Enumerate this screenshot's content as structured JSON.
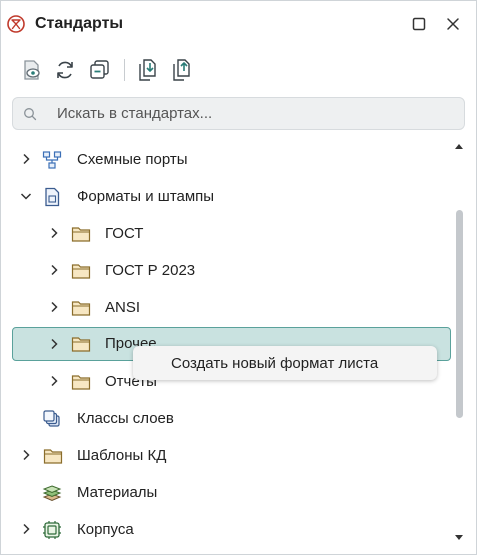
{
  "window": {
    "title": "Стандарты",
    "maximize_icon": "square-icon",
    "close_icon": "close-icon"
  },
  "toolbar": {
    "buttons": [
      {
        "name": "view-icon"
      },
      {
        "name": "refresh-icon"
      },
      {
        "name": "collapse-icon"
      },
      {
        "name": "import-icon"
      },
      {
        "name": "export-icon"
      }
    ]
  },
  "search": {
    "placeholder": "Искать в стандартах...",
    "value": ""
  },
  "tree": {
    "items": [
      {
        "label": "Схемные порты",
        "icon": "network-ports-icon",
        "expandable": true,
        "expanded": false,
        "level": 0
      },
      {
        "label": "Форматы и штампы",
        "icon": "document-icon",
        "expandable": true,
        "expanded": true,
        "level": 0
      },
      {
        "label": "ГОСТ",
        "icon": "folder-icon",
        "expandable": true,
        "expanded": false,
        "level": 1
      },
      {
        "label": "ГОСТ Р 2023",
        "icon": "folder-icon",
        "expandable": true,
        "expanded": false,
        "level": 1
      },
      {
        "label": "ANSI",
        "icon": "folder-icon",
        "expandable": true,
        "expanded": false,
        "level": 1
      },
      {
        "label": "Прочее",
        "icon": "folder-icon",
        "expandable": true,
        "expanded": false,
        "level": 1,
        "selected": true
      },
      {
        "label": "Отчеты",
        "icon": "folder-icon",
        "expandable": true,
        "expanded": false,
        "level": 1
      },
      {
        "label": "Классы слоев",
        "icon": "layers-icon",
        "expandable": false,
        "level": 0
      },
      {
        "label": "Шаблоны КД",
        "icon": "folder-icon",
        "expandable": true,
        "expanded": false,
        "level": 0
      },
      {
        "label": "Материалы",
        "icon": "materials-icon",
        "expandable": false,
        "level": 0
      },
      {
        "label": "Корпуса",
        "icon": "package-icon",
        "expandable": true,
        "expanded": false,
        "level": 0
      }
    ]
  },
  "context_menu": {
    "items": [
      {
        "label": "Создать новый формат листа"
      }
    ]
  },
  "colors": {
    "selection_bg": "#c9e2e0",
    "selection_border": "#5aa19b",
    "accent": "#2a7d78",
    "folder_fill": "#f7e7c3",
    "folder_stroke": "#8a6d2b",
    "app_icon": "#c0392b"
  }
}
